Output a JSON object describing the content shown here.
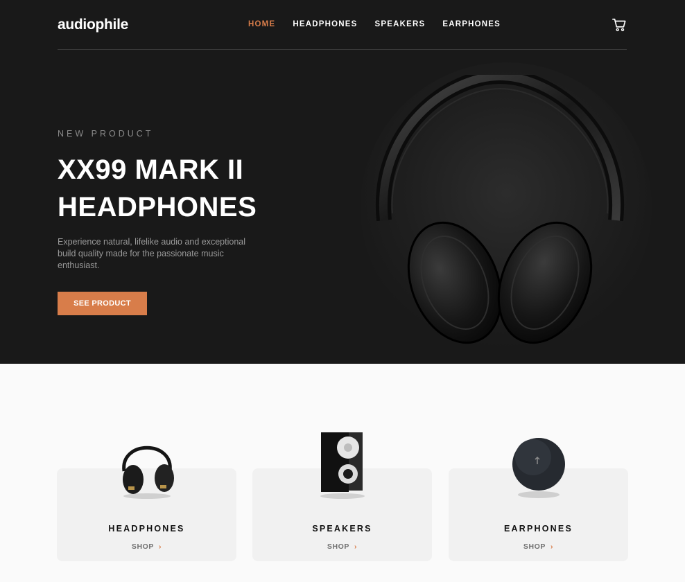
{
  "brand": {
    "logo": "audiophile",
    "accent": "#d87d4a"
  },
  "nav": {
    "items": [
      {
        "label": "HOME",
        "active": true
      },
      {
        "label": "HEADPHONES",
        "active": false
      },
      {
        "label": "SPEAKERS",
        "active": false
      },
      {
        "label": "EARPHONES",
        "active": false
      }
    ],
    "cart_icon": "cart-icon"
  },
  "hero": {
    "eyebrow": "NEW PRODUCT",
    "title_line1": "XX99 MARK II",
    "title_line2": "HEADPHONES",
    "description": "Experience natural, lifelike audio and exceptional build quality made for the passionate music enthusiast.",
    "cta_label": "SEE PRODUCT",
    "image_icon": "headphones-image"
  },
  "categories": [
    {
      "name": "HEADPHONES",
      "shop_label": "SHOP",
      "chevron": "›",
      "image_icon": "headphones-thumbnail"
    },
    {
      "name": "SPEAKERS",
      "shop_label": "SHOP",
      "chevron": "›",
      "image_icon": "speaker-thumbnail"
    },
    {
      "name": "EARPHONES",
      "shop_label": "SHOP",
      "chevron": "›",
      "image_icon": "earphones-case-thumbnail"
    }
  ]
}
